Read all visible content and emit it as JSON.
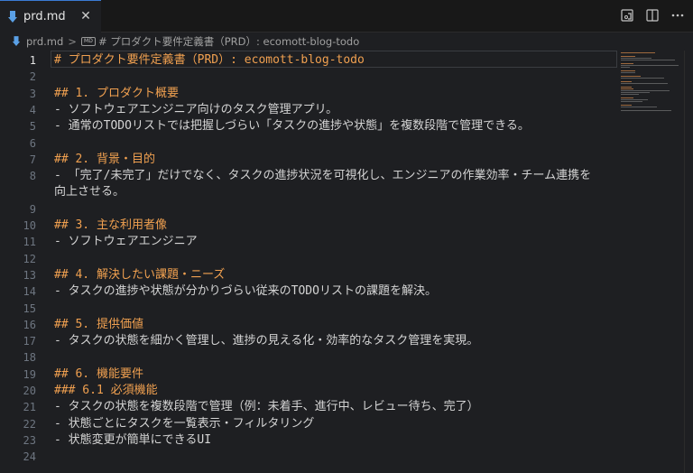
{
  "tab": {
    "label": "prd.md",
    "close": "✕"
  },
  "breadcrumb": {
    "file": "prd.md",
    "sep": ">",
    "md_badge": "MD",
    "heading": "# プロダクト要件定義書（PRD）: ecomott-blog-todo"
  },
  "lines": [
    {
      "n": "1",
      "text": "# プロダクト要件定義書（PRD）: ecomott-blog-todo",
      "kind": "h1"
    },
    {
      "n": "2",
      "text": "",
      "kind": "text"
    },
    {
      "n": "3",
      "text": "## 1. プロダクト概要",
      "kind": "h2"
    },
    {
      "n": "4",
      "text": "- ソフトウェアエンジニア向けのタスク管理アプリ。",
      "kind": "text"
    },
    {
      "n": "5",
      "text": "- 通常のTODOリストでは把握しづらい「タスクの進捗や状態」を複数段階で管理できる。",
      "kind": "text"
    },
    {
      "n": "6",
      "text": "",
      "kind": "text"
    },
    {
      "n": "7",
      "text": "## 2. 背景・目的",
      "kind": "h2"
    },
    {
      "n": "8",
      "text": "- 「完了/未完了」だけでなく、タスクの進捗状況を可視化し、エンジニアの作業効率・チーム連携を",
      "kind": "text"
    },
    {
      "n": "",
      "text": "向上させる。",
      "kind": "text"
    },
    {
      "n": "9",
      "text": "",
      "kind": "text"
    },
    {
      "n": "10",
      "text": "## 3. 主な利用者像",
      "kind": "h2"
    },
    {
      "n": "11",
      "text": "- ソフトウェアエンジニア",
      "kind": "text"
    },
    {
      "n": "12",
      "text": "",
      "kind": "text"
    },
    {
      "n": "13",
      "text": "## 4. 解決したい課題・ニーズ",
      "kind": "h2"
    },
    {
      "n": "14",
      "text": "- タスクの進捗や状態が分かりづらい従来のTODOリストの課題を解決。",
      "kind": "text"
    },
    {
      "n": "15",
      "text": "",
      "kind": "text"
    },
    {
      "n": "16",
      "text": "## 5. 提供価値",
      "kind": "h2"
    },
    {
      "n": "17",
      "text": "- タスクの状態を細かく管理し、進捗の見える化・効率的なタスク管理を実現。",
      "kind": "text"
    },
    {
      "n": "18",
      "text": "",
      "kind": "text"
    },
    {
      "n": "19",
      "text": "## 6. 機能要件",
      "kind": "h2"
    },
    {
      "n": "20",
      "text": "### 6.1 必須機能",
      "kind": "h2"
    },
    {
      "n": "21",
      "text": "- タスクの状態を複数段階で管理（例：未着手、進行中、レビュー待ち、完了）",
      "kind": "text"
    },
    {
      "n": "22",
      "text": "- 状態ごとにタスクを一覧表示・フィルタリング",
      "kind": "text"
    },
    {
      "n": "23",
      "text": "- 状態変更が簡単にできるUI",
      "kind": "text"
    },
    {
      "n": "24",
      "text": "",
      "kind": "text"
    }
  ],
  "colors": {
    "heading": "#f0a050",
    "text": "#d4d4d4",
    "line_number": "#6e7681",
    "background": "#1e1f22"
  }
}
